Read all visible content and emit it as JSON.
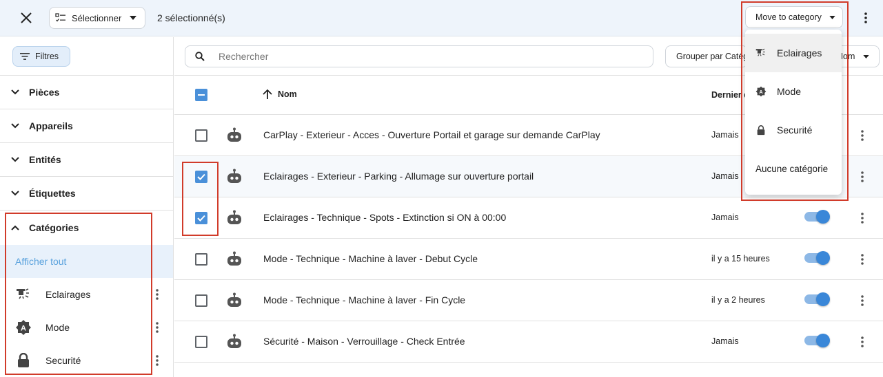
{
  "topbar": {
    "select_label": "Sélectionner",
    "selected_count": "2 sélectionné(s)",
    "move_label": "Move to category"
  },
  "sidebar": {
    "filters_label": "Filtres",
    "sections": [
      "Pièces",
      "Appareils",
      "Entités",
      "Étiquettes"
    ],
    "categories_label": "Catégories",
    "show_all": "Afficher tout",
    "categories": [
      {
        "label": "Eclairages",
        "icon": "ceiling-light-icon"
      },
      {
        "label": "Mode",
        "icon": "mode-badge-icon"
      },
      {
        "label": "Securité",
        "icon": "lock-icon"
      }
    ]
  },
  "toolbar": {
    "search_placeholder": "Rechercher",
    "group_label": "Grouper par Catégorie",
    "sort_label": "Nom"
  },
  "table": {
    "headers": {
      "name": "Nom",
      "last": "Dernier déclenchement"
    },
    "rows": [
      {
        "name": "CarPlay - Exterieur - Acces - Ouverture Portail et garage sur demande CarPlay",
        "last": "Jamais",
        "checked": false
      },
      {
        "name": "Eclairages - Exterieur - Parking - Allumage sur ouverture portail",
        "last": "Jamais",
        "checked": true
      },
      {
        "name": "Eclairages - Technique - Spots - Extinction si ON à 00:00",
        "last": "Jamais",
        "checked": true
      },
      {
        "name": "Mode - Technique - Machine à laver - Debut Cycle",
        "last": "il y a 15 heures",
        "checked": false
      },
      {
        "name": "Mode - Technique - Machine à laver - Fin Cycle",
        "last": "il y a 2 heures",
        "checked": false
      },
      {
        "name": "Sécurité - Maison - Verrouillage - Check Entrée",
        "last": "Jamais",
        "checked": false
      }
    ]
  },
  "dropdown": {
    "items": [
      {
        "label": "Eclairages",
        "icon": "ceiling-light-icon"
      },
      {
        "label": "Mode",
        "icon": "mode-badge-icon"
      },
      {
        "label": "Securité",
        "icon": "lock-icon"
      }
    ],
    "none_label": "Aucune catégorie"
  },
  "colors": {
    "accent": "#4a90d9",
    "annotation": "#d13b2a",
    "show_all_text": "#5aa2dd"
  }
}
